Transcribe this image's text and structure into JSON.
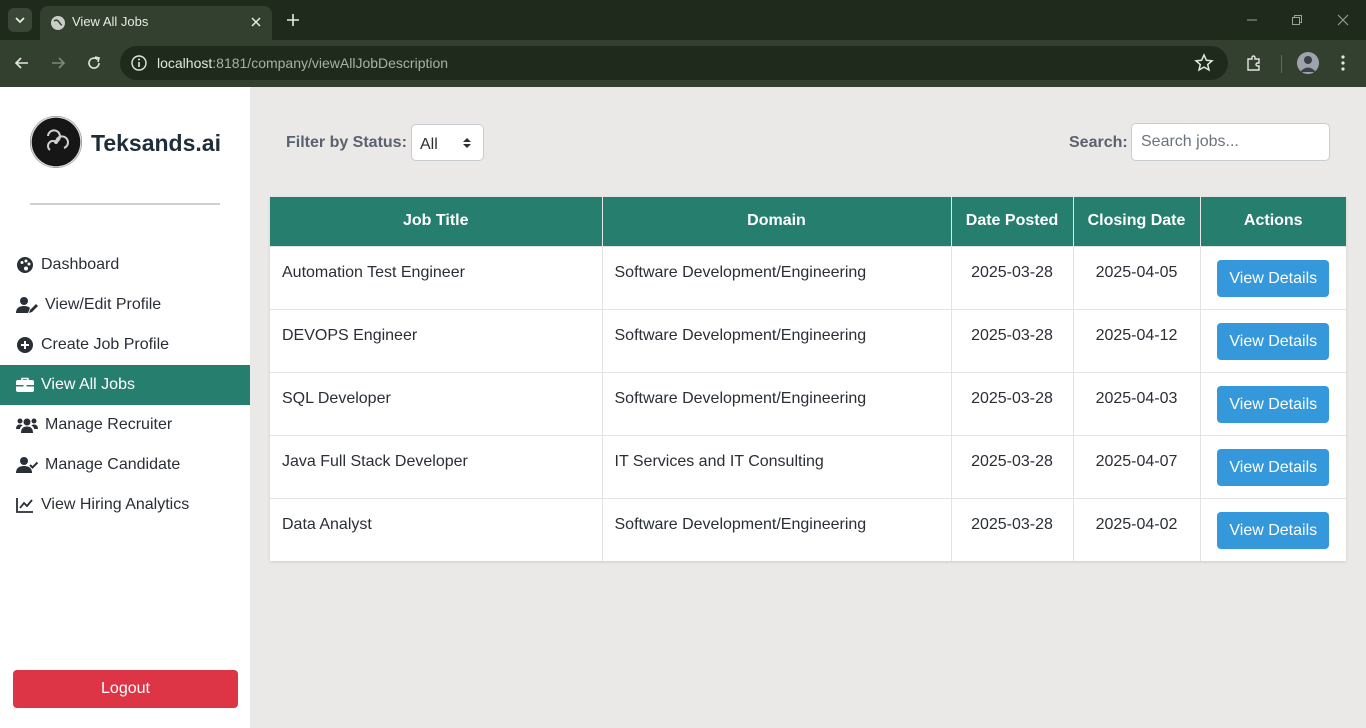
{
  "browser": {
    "tab_title": "View All Jobs",
    "url_host": "localhost",
    "url_rest": ":8181/company/viewAllJobDescription"
  },
  "sidebar": {
    "brand": "Teksands.ai",
    "items": [
      {
        "label": "Dashboard",
        "icon": "palette-icon"
      },
      {
        "label": "View/Edit Profile",
        "icon": "user-edit-icon"
      },
      {
        "label": "Create Job Profile",
        "icon": "plus-circle-icon"
      },
      {
        "label": "View All Jobs",
        "icon": "briefcase-icon",
        "active": true
      },
      {
        "label": "Manage Recruiter",
        "icon": "users-icon"
      },
      {
        "label": "Manage Candidate",
        "icon": "user-check-icon"
      },
      {
        "label": "View Hiring Analytics",
        "icon": "chart-line-icon"
      }
    ],
    "logout_label": "Logout"
  },
  "filters": {
    "status_label": "Filter by Status:",
    "status_value": "All",
    "search_label": "Search:",
    "search_placeholder": "Search jobs..."
  },
  "table": {
    "headers": [
      "Job Title",
      "Domain",
      "Date Posted",
      "Closing Date",
      "Actions"
    ],
    "action_label": "View Details",
    "rows": [
      {
        "title": "Automation Test Engineer",
        "domain": "Software Development/Engineering",
        "posted": "2025-03-28",
        "closing": "2025-04-05"
      },
      {
        "title": "DEVOPS Engineer",
        "domain": "Software Development/Engineering",
        "posted": "2025-03-28",
        "closing": "2025-04-12"
      },
      {
        "title": "SQL Developer",
        "domain": "Software Development/Engineering",
        "posted": "2025-03-28",
        "closing": "2025-04-03"
      },
      {
        "title": "Java Full Stack Developer",
        "domain": "IT Services and IT Consulting",
        "posted": "2025-03-28",
        "closing": "2025-04-07"
      },
      {
        "title": "Data Analyst",
        "domain": "Software Development/Engineering",
        "posted": "2025-03-28",
        "closing": "2025-04-02"
      }
    ]
  },
  "colors": {
    "accent": "#267e6f",
    "button": "#3498db",
    "logout": "#dd3545"
  }
}
